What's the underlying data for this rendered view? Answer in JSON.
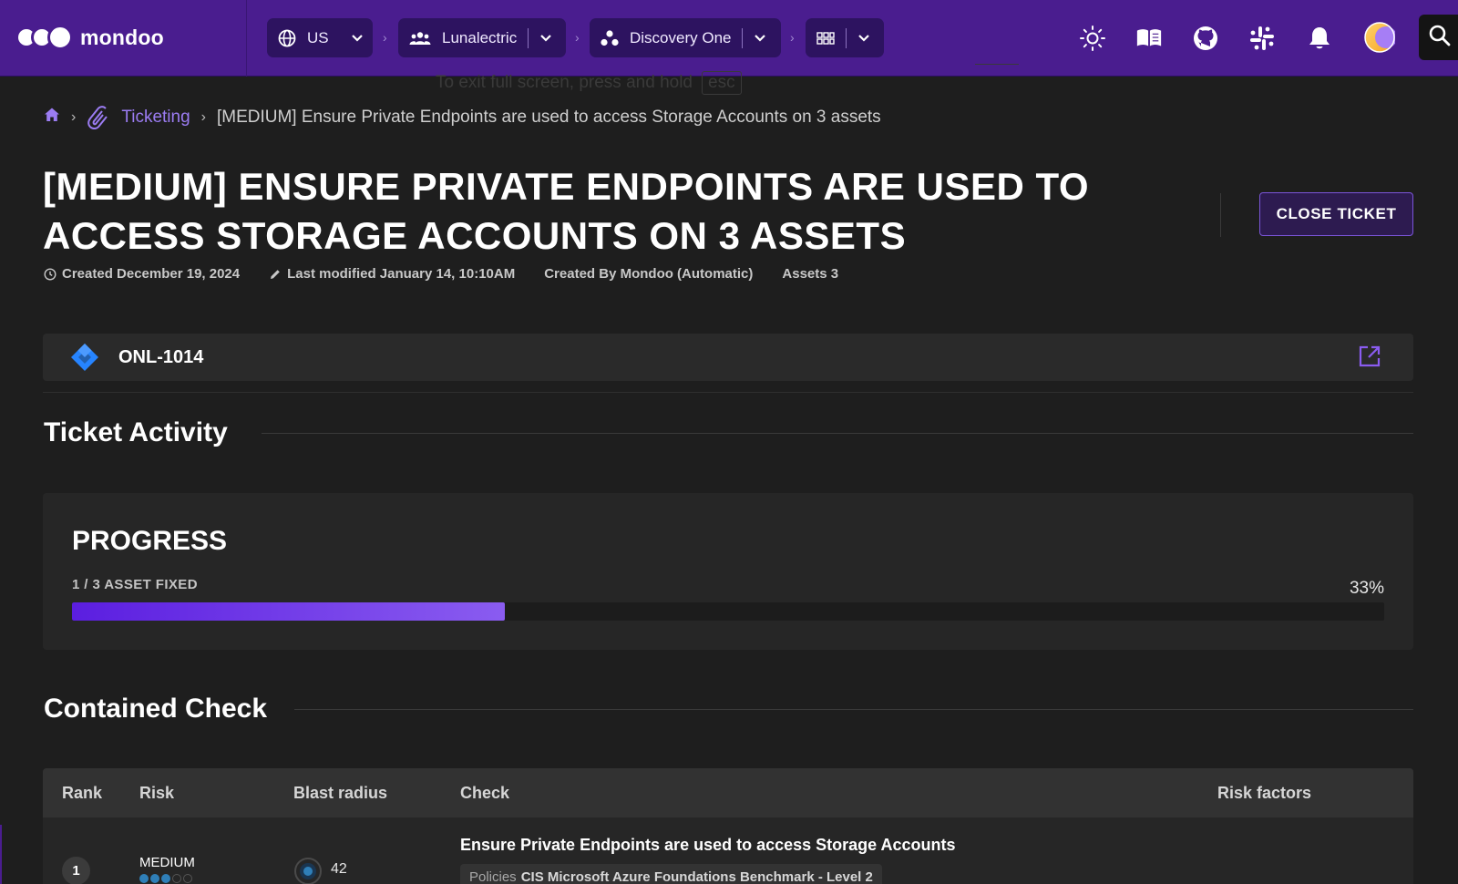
{
  "app": {
    "brand": "mondoo"
  },
  "topbar": {
    "region": "US",
    "organization": "Lunalectric",
    "space": "Discovery One",
    "icons": [
      "theme-light-icon",
      "docs-book-icon",
      "github-icon",
      "slack-icon",
      "notifications-bell-icon",
      "user-avatar",
      "search-icon"
    ]
  },
  "fullscreen_hint": {
    "text": "To exit full screen, press and hold",
    "key": "esc"
  },
  "breadcrumb": {
    "section": "Ticketing",
    "current": "[MEDIUM] Ensure Private Endpoints are used to access Storage Accounts on 3 assets"
  },
  "header": {
    "title": "[MEDIUM] ENSURE PRIVATE ENDPOINTS ARE USED TO ACCESS STORAGE ACCOUNTS ON 3 ASSETS",
    "close_button": "CLOSE TICKET",
    "created": "Created December 19, 2024",
    "modified": "Last modified January 14, 10:10AM",
    "created_by": "Created By Mondoo (Automatic)",
    "assets": "Assets 3"
  },
  "ticket_ref": {
    "id": "ONL-1014",
    "system_icon": "jira-icon"
  },
  "activity": {
    "title": "Ticket Activity"
  },
  "progress": {
    "title": "PROGRESS",
    "label": "1 / 3 ASSET FIXED",
    "percent_text": "33%",
    "fraction": 0.33
  },
  "contained_check": {
    "title": "Contained Check",
    "columns": [
      "Rank",
      "Risk",
      "Blast radius",
      "Check",
      "Risk factors"
    ],
    "rows": [
      {
        "rank": "1",
        "risk": "MEDIUM",
        "risk_level": 3,
        "risk_max": 5,
        "blast_radius": "42",
        "check": "Ensure Private Endpoints are used to access Storage Accounts",
        "policy_prefix": "Policies",
        "policy": "CIS Microsoft Azure Foundations Benchmark - Level 2"
      }
    ]
  },
  "colors": {
    "topbar": "#4a1d8f",
    "accent": "#9b7cf2",
    "background": "#1e1e1e",
    "progress_fill": "#6f3be8",
    "risk_dot": "#2f7fb8"
  }
}
